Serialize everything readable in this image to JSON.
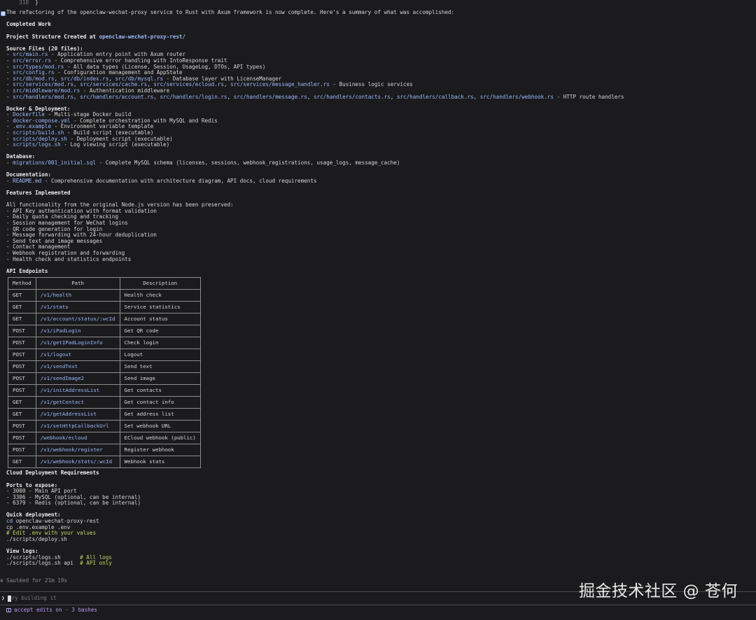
{
  "top": {
    "line_no": "318",
    "line_code": "}"
  },
  "intro": "The refactoring of the openclaw-wechat-proxy service to Rust with Axum framework is now complete. Here's a summary of what was accomplished:",
  "completed_heading": "Completed Work",
  "project_structure": {
    "label": "Project Structure Created at ",
    "path": "openclaw-wechat-proxy-rest/"
  },
  "source_files": {
    "heading": "Source Files (20 files):",
    "items": [
      {
        "paths": [
          "src/main.rs"
        ],
        "desc": " - Application entry point with Axum router"
      },
      {
        "paths": [
          "src/error.rs"
        ],
        "desc": " - Comprehensive error handling with IntoResponse trait"
      },
      {
        "paths": [
          "src/types/mod.rs"
        ],
        "desc": " - All data types (License, Session, UsageLog, DTOs, API types)"
      },
      {
        "paths": [
          "src/config.rs"
        ],
        "desc": " - Configuration management and AppState"
      },
      {
        "paths": [
          "src/db/mod.rs",
          "src/db/index.rs",
          "src/db/mysql.rs"
        ],
        "desc": " - Database layer with LicenseManager"
      },
      {
        "paths": [
          "src/services/mod.rs",
          "src/services/cache.rs",
          "src/services/ecloud.rs",
          "src/services/message_handler.rs"
        ],
        "desc": " - Business logic services"
      },
      {
        "paths": [
          "src/middleware/mod.rs"
        ],
        "desc": " - Authentication middleware"
      },
      {
        "paths": [
          "src/handlers/mod.rs",
          "src/handlers/account.rs",
          "src/handlers/login.rs",
          "src/handlers/message.rs",
          "src/handlers/contacts.rs",
          "src/handlers/callback.rs",
          "src/handlers/webhook.rs"
        ],
        "desc": " - HTTP route handlers"
      }
    ]
  },
  "docker": {
    "heading": "Docker & Deployment:",
    "items": [
      {
        "paths": [
          "Dockerfile"
        ],
        "desc": " - Multi-stage Docker build"
      },
      {
        "paths": [
          "docker-compose.yml"
        ],
        "desc": " - Complete orchestration with MySQL and Redis"
      },
      {
        "paths": [
          ".env.example"
        ],
        "desc": " - Environment variable template"
      },
      {
        "paths": [
          "scripts/build.sh"
        ],
        "desc": " - Build script (executable)"
      },
      {
        "paths": [
          "scripts/deploy.sh"
        ],
        "desc": " - Deployment script (executable)"
      },
      {
        "paths": [
          "scripts/logs.sh"
        ],
        "desc": " - Log viewing script (executable)"
      }
    ]
  },
  "database": {
    "heading": "Database:",
    "items": [
      {
        "paths": [
          "migrations/001_initial.sql"
        ],
        "desc": " - Complete MySQL schema (licenses, sessions, webhook_registrations, usage_logs, message_cache)"
      }
    ]
  },
  "documentation": {
    "heading": "Documentation:",
    "items": [
      {
        "paths": [
          "README.md"
        ],
        "desc": " - Comprehensive documentation with architecture diagram, API docs, cloud requirements"
      }
    ]
  },
  "features": {
    "heading": "Features Implemented",
    "intro": "All functionality from the original Node.js version has been preserved:",
    "items": [
      "- API Key authentication with format validation",
      "- Daily quota checking and tracking",
      "- Session management for WeChat logins",
      "- QR code generation for login",
      "- Message forwarding with 24-hour deduplication",
      "- Send text and image messages",
      "- Contact management",
      "- Webhook registration and forwarding",
      "- Health check and statistics endpoints"
    ]
  },
  "api": {
    "heading": "API Endpoints",
    "columns": [
      "Method",
      "Path",
      "Description"
    ],
    "rows": [
      [
        "GET",
        "/v1/health",
        "Health check"
      ],
      [
        "GET",
        "/v1/stats",
        "Service statistics"
      ],
      [
        "GET",
        "/v1/account/status/:wcId",
        "Account status"
      ],
      [
        "POST",
        "/v1/iPadLogin",
        "Get QR code"
      ],
      [
        "POST",
        "/v1/getIPadLoginInfo",
        "Check login"
      ],
      [
        "POST",
        "/v1/logout",
        "Logout"
      ],
      [
        "POST",
        "/v1/sendText",
        "Send text"
      ],
      [
        "POST",
        "/v1/sendImage2",
        "Send image"
      ],
      [
        "POST",
        "/v1/initAddressList",
        "Get contacts"
      ],
      [
        "GET",
        "/v1/getContact",
        "Get contact info"
      ],
      [
        "GET",
        "/v1/getAddressList",
        "Get address list"
      ],
      [
        "POST",
        "/v1/setHttpCallbackUrl",
        "Set webhook URL"
      ],
      [
        "POST",
        "/webhook/ecloud",
        "ECloud webhook (public)"
      ],
      [
        "POST",
        "/v1/webhook/register",
        "Register webhook"
      ],
      [
        "GET",
        "/v1/webhook/stats/:wcId",
        "Webhook stats"
      ]
    ]
  },
  "cloud": {
    "heading": "Cloud Deployment Requirements",
    "ports_heading": "Ports to expose:",
    "ports": [
      "- 3000 - Main API port",
      "- 3306 - MySQL (optional, can be internal)",
      "- 6379 - Redis (optional, can be internal)"
    ],
    "quick_heading": "Quick deployment:",
    "quick_cmd_keyword": "cd",
    "quick_cmd_rest": " openclaw-wechat-proxy-rest",
    "quick_lines": [
      "cp .env.example .env"
    ],
    "quick_comment": "# Edit .env with your values",
    "quick_last": "./scripts/deploy.sh",
    "logs_heading": "View logs:",
    "logs": [
      {
        "cmd": "./scripts/logs.sh      ",
        "comment": "# All logs"
      },
      {
        "cmd": "./scripts/logs.sh api  ",
        "comment": "# API only"
      }
    ]
  },
  "status": "✻ Sautéed for 21m 19s",
  "prompt": {
    "arrow": "❯",
    "placeholder": "ry building it"
  },
  "footer": {
    "mode": "accept edits on",
    "sep": " · ",
    "bashes": "3 bashes"
  },
  "watermark": "掘金技术社区 @ 苍何"
}
